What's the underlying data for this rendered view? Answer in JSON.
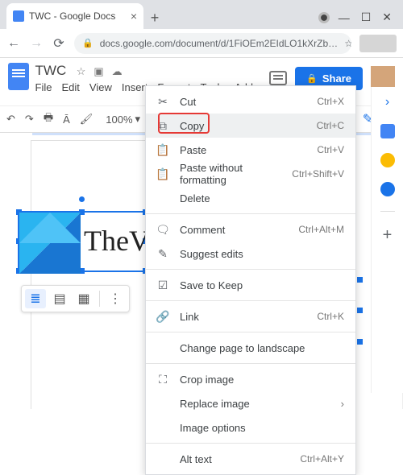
{
  "browser": {
    "tab_title": "TWC - Google Docs",
    "url": "docs.google.com/document/d/1FiOEm2EIdLO1kXrZb…"
  },
  "docs": {
    "title": "TWC",
    "menus": [
      "File",
      "Edit",
      "View",
      "Insert",
      "Format",
      "Tools",
      "Add-ons"
    ],
    "share_label": "Share",
    "zoom": "100%"
  },
  "canvas": {
    "visible_text": "TheV"
  },
  "context_menu": {
    "items": [
      {
        "icon": "✂",
        "label": "Cut",
        "shortcut": "Ctrl+X"
      },
      {
        "icon": "⧉",
        "label": "Copy",
        "shortcut": "Ctrl+C",
        "highlight": true
      },
      {
        "icon": "📋",
        "label": "Paste",
        "shortcut": "Ctrl+V"
      },
      {
        "icon": "📋",
        "label": "Paste without formatting",
        "shortcut": "Ctrl+Shift+V"
      },
      {
        "icon": "",
        "label": "Delete",
        "shortcut": ""
      },
      {
        "sep": true
      },
      {
        "icon": "🗨",
        "label": "Comment",
        "shortcut": "Ctrl+Alt+M"
      },
      {
        "icon": "✎",
        "label": "Suggest edits",
        "shortcut": ""
      },
      {
        "sep": true
      },
      {
        "icon": "☑",
        "label": "Save to Keep",
        "shortcut": ""
      },
      {
        "sep": true
      },
      {
        "icon": "🔗",
        "label": "Link",
        "shortcut": "Ctrl+K"
      },
      {
        "sep": true
      },
      {
        "icon": "",
        "label": "Change page to landscape",
        "shortcut": ""
      },
      {
        "sep": true
      },
      {
        "icon": "⛶",
        "label": "Crop image",
        "shortcut": ""
      },
      {
        "icon": "",
        "label": "Replace image",
        "shortcut": "",
        "submenu": true
      },
      {
        "icon": "",
        "label": "Image options",
        "shortcut": ""
      },
      {
        "sep": true
      },
      {
        "icon": "",
        "label": "Alt text",
        "shortcut": "Ctrl+Alt+Y"
      }
    ]
  }
}
